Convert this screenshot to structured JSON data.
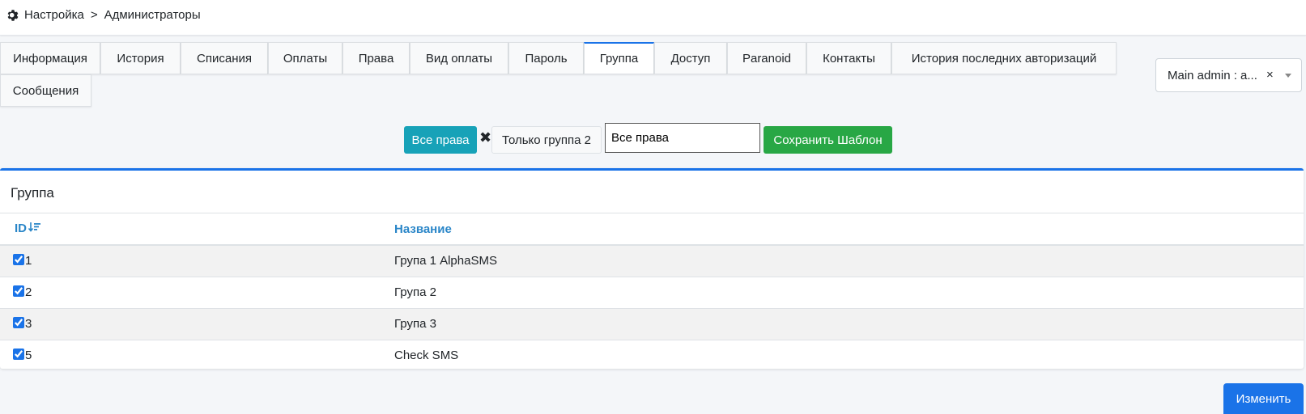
{
  "breadcrumb": {
    "root": "Настройка",
    "separator": ">",
    "current": "Администраторы"
  },
  "tabs": [
    "Информация",
    "История",
    "Списания",
    "Оплаты",
    "Права",
    "Вид оплаты",
    "Пароль",
    "Группа",
    "Доступ",
    "Paranoid",
    "Контакты",
    "История последних авторизаций",
    "Сообщения"
  ],
  "active_tab": "Группа",
  "admin_select": {
    "value": "Main admin : a...",
    "clear": "×"
  },
  "toolbar": {
    "all_rights_label": "Все права",
    "remove_symbol": "✖",
    "only_group_label": "Только группа 2",
    "template_name_value": "Все права",
    "save_template_label": "Сохранить Шаблон"
  },
  "card": {
    "title": "Группа",
    "columns": {
      "id": "ID",
      "name": "Название"
    },
    "rows": [
      {
        "id": "1",
        "name": "Група 1 AlphaSMS",
        "checked": true
      },
      {
        "id": "2",
        "name": "Група 2",
        "checked": true
      },
      {
        "id": "3",
        "name": "Група 3",
        "checked": true
      },
      {
        "id": "5",
        "name": "Check SMS",
        "checked": true
      }
    ]
  },
  "submit_label": "Изменить",
  "colors": {
    "accent": "#1a73e8",
    "info": "#17a2b8",
    "success": "#28a745",
    "header_link": "#2a86c8"
  }
}
